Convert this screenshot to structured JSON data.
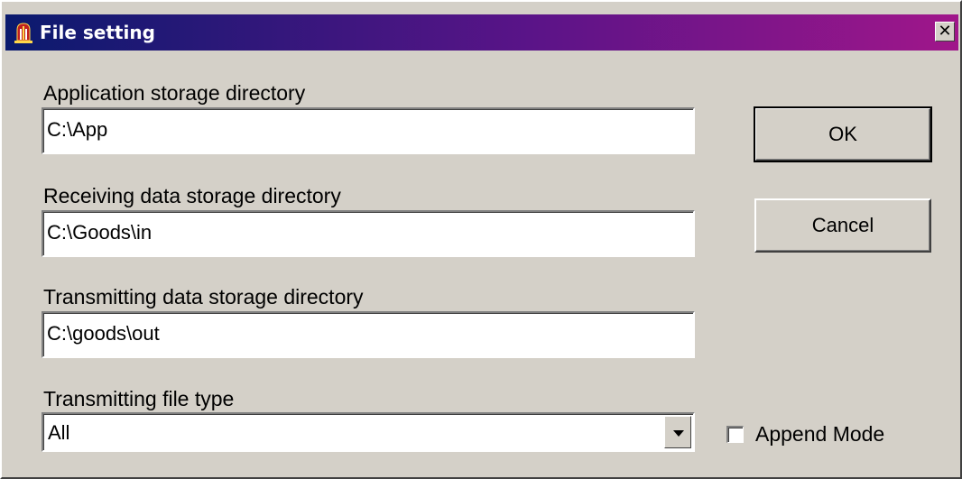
{
  "window": {
    "title": "File setting",
    "close_label": "✕"
  },
  "form": {
    "app_dir": {
      "label": "Application storage directory",
      "value": "C:\\App"
    },
    "recv_dir": {
      "label": "Receiving data storage directory",
      "value": "C:\\Goods\\in"
    },
    "trans_dir": {
      "label": "Transmitting data storage directory",
      "value": "C:\\goods\\out"
    },
    "file_type": {
      "label": "Transmitting file type",
      "selected": "All"
    },
    "append_mode": {
      "label": "Append Mode",
      "checked": false
    }
  },
  "buttons": {
    "ok": "OK",
    "cancel": "Cancel"
  },
  "colors": {
    "title_gradient_start": "#0a1a6e",
    "title_gradient_end": "#a0168a",
    "face": "#d4d0c8"
  }
}
